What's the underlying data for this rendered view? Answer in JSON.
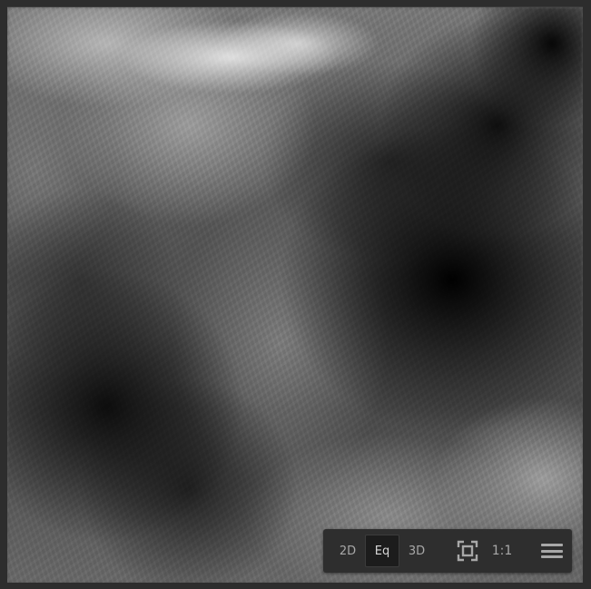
{
  "viewer": {
    "view_modes": [
      {
        "label": "2D",
        "active": false
      },
      {
        "label": "Eq",
        "active": true
      },
      {
        "label": "3D",
        "active": false
      }
    ],
    "fit_icon": "fit-to-view-icon",
    "actual_size_label": "1:1",
    "menu_icon": "hamburger-menu-icon"
  },
  "colors": {
    "background": "#2d2d2d",
    "toolbar": "#2e2e2e",
    "active_button": "#1c1c1c",
    "text": "#a8a8a8"
  }
}
